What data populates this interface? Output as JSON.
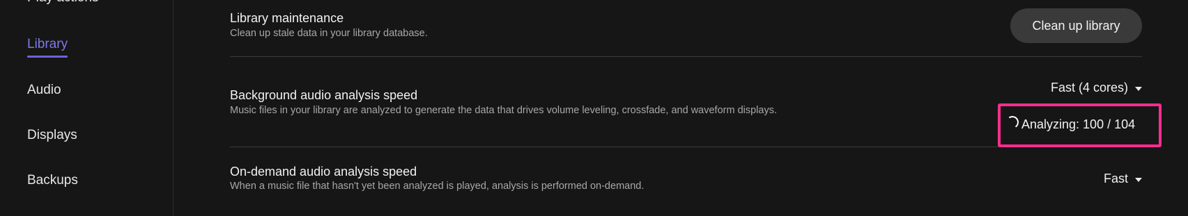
{
  "sidebar": {
    "items": [
      {
        "label": "Play actions"
      },
      {
        "label": "Library",
        "active": true
      },
      {
        "label": "Audio"
      },
      {
        "label": "Displays"
      },
      {
        "label": "Backups"
      }
    ]
  },
  "settings": {
    "library_maintenance": {
      "title": "Library maintenance",
      "description": "Clean up stale data in your library database.",
      "button_label": "Clean up library"
    },
    "background_analysis": {
      "title": "Background audio analysis speed",
      "description": "Music files in your library are analyzed to generate the data that drives volume leveling, crossfade, and waveform displays.",
      "selected_value": "Fast (4 cores)",
      "status_text": "Analyzing: 100 / 104"
    },
    "on_demand_analysis": {
      "title": "On-demand audio analysis speed",
      "description": "When a music file that hasn't yet been analyzed is played, analysis is performed on-demand.",
      "selected_value": "Fast"
    }
  },
  "colors": {
    "background": "#161616",
    "accent": "#7f7ae6",
    "highlight_box": "#ff2d8f",
    "button_bg": "#3a3a3a"
  },
  "icons": {
    "dropdown": "caret-down-icon",
    "progress": "spinner-icon"
  }
}
